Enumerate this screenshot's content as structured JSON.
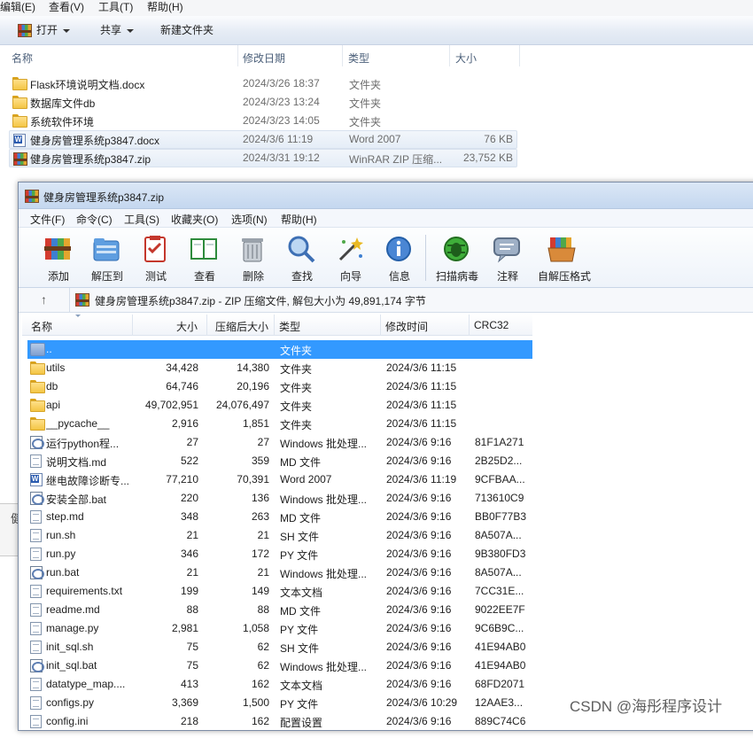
{
  "explorer": {
    "menu": [
      "编辑(E)",
      "查看(V)",
      "工具(T)",
      "帮助(H)"
    ],
    "toolbar": {
      "open": "打开",
      "share": "共享",
      "new_folder": "新建文件夹"
    },
    "columns": {
      "name": "名称",
      "date": "修改日期",
      "type": "类型",
      "size": "大小"
    },
    "rows": [
      {
        "icon": "folder-icon",
        "name": "Flask环境说明文档.docx",
        "date": "2024/3/26 18:37",
        "type": "文件夹",
        "size": ""
      },
      {
        "icon": "folder-icon",
        "name": "数据库文件db",
        "date": "2024/3/23 13:24",
        "type": "文件夹",
        "size": ""
      },
      {
        "icon": "folder-icon",
        "name": "系统软件环境",
        "date": "2024/3/23 14:05",
        "type": "文件夹",
        "size": ""
      },
      {
        "icon": "word-doc-icon",
        "name": "健身房管理系统p3847.docx",
        "date": "2024/3/6 11:19",
        "type": "Word 2007",
        "size": "76 KB"
      },
      {
        "icon": "rar-archive-icon",
        "name": "健身房管理系统p3847.zip",
        "date": "2024/3/31 19:12",
        "type": "WinRAR ZIP 压缩...",
        "size": "23,752 KB"
      }
    ]
  },
  "winrar": {
    "title": "健身房管理系统p3847.zip",
    "menu": [
      "文件(F)",
      "命令(C)",
      "工具(S)",
      "收藏夹(O)",
      "选项(N)",
      "帮助(H)"
    ],
    "tools": [
      {
        "label": "添加",
        "icon": "add-archive-icon"
      },
      {
        "label": "解压到",
        "icon": "extract-to-icon"
      },
      {
        "label": "测试",
        "icon": "test-icon"
      },
      {
        "label": "查看",
        "icon": "view-book-icon"
      },
      {
        "label": "删除",
        "icon": "trash-icon"
      },
      {
        "label": "查找",
        "icon": "find-magnifier-icon"
      },
      {
        "label": "向导",
        "icon": "wizard-wand-icon"
      },
      {
        "label": "信息",
        "icon": "info-icon"
      },
      {
        "label": "扫描病毒",
        "icon": "virus-scan-icon"
      },
      {
        "label": "注释",
        "icon": "comment-icon"
      },
      {
        "label": "自解压格式",
        "icon": "sfx-archive-icon"
      }
    ],
    "address": "健身房管理系统p3847.zip - ZIP 压缩文件, 解包大小为 49,891,174 字节",
    "columns": {
      "name": "名称",
      "size": "大小",
      "packed": "压缩后大小",
      "type": "类型",
      "modified": "修改时间",
      "crc": "CRC32"
    },
    "files": [
      {
        "icon": "parent-folder-icon",
        "name": "..",
        "size": "",
        "packed": "",
        "type": "文件夹",
        "modified": "",
        "crc": "",
        "selected": true
      },
      {
        "icon": "folder-icon",
        "name": "utils",
        "size": "34,428",
        "packed": "14,380",
        "type": "文件夹",
        "modified": "2024/3/6 11:15",
        "crc": ""
      },
      {
        "icon": "folder-icon",
        "name": "db",
        "size": "64,746",
        "packed": "20,196",
        "type": "文件夹",
        "modified": "2024/3/6 11:15",
        "crc": ""
      },
      {
        "icon": "folder-icon",
        "name": "api",
        "size": "49,702,951",
        "packed": "24,076,497",
        "type": "文件夹",
        "modified": "2024/3/6 11:15",
        "crc": ""
      },
      {
        "icon": "folder-icon",
        "name": "__pycache__",
        "size": "2,916",
        "packed": "1,851",
        "type": "文件夹",
        "modified": "2024/3/6 11:15",
        "crc": ""
      },
      {
        "icon": "batch-file-icon",
        "name": "运行python程...",
        "size": "27",
        "packed": "27",
        "type": "Windows 批处理...",
        "modified": "2024/3/6 9:16",
        "crc": "81F1A271"
      },
      {
        "icon": "text-file-icon",
        "name": "说明文档.md",
        "size": "522",
        "packed": "359",
        "type": "MD 文件",
        "modified": "2024/3/6 9:16",
        "crc": "2B25D2..."
      },
      {
        "icon": "word-doc-icon",
        "name": "继电故障诊断专...",
        "size": "77,210",
        "packed": "70,391",
        "type": "Word 2007",
        "modified": "2024/3/6 11:19",
        "crc": "9CFBAA..."
      },
      {
        "icon": "batch-file-icon",
        "name": "安装全部.bat",
        "size": "220",
        "packed": "136",
        "type": "Windows 批处理...",
        "modified": "2024/3/6 9:16",
        "crc": "713610C9"
      },
      {
        "icon": "text-file-icon",
        "name": "step.md",
        "size": "348",
        "packed": "263",
        "type": "MD 文件",
        "modified": "2024/3/6 9:16",
        "crc": "BB0F77B3"
      },
      {
        "icon": "text-file-icon",
        "name": "run.sh",
        "size": "21",
        "packed": "21",
        "type": "SH 文件",
        "modified": "2024/3/6 9:16",
        "crc": "8A507A..."
      },
      {
        "icon": "text-file-icon",
        "name": "run.py",
        "size": "346",
        "packed": "172",
        "type": "PY 文件",
        "modified": "2024/3/6 9:16",
        "crc": "9B380FD3"
      },
      {
        "icon": "batch-file-icon",
        "name": "run.bat",
        "size": "21",
        "packed": "21",
        "type": "Windows 批处理...",
        "modified": "2024/3/6 9:16",
        "crc": "8A507A..."
      },
      {
        "icon": "text-file-icon",
        "name": "requirements.txt",
        "size": "199",
        "packed": "149",
        "type": "文本文档",
        "modified": "2024/3/6 9:16",
        "crc": "7CC31E..."
      },
      {
        "icon": "text-file-icon",
        "name": "readme.md",
        "size": "88",
        "packed": "88",
        "type": "MD 文件",
        "modified": "2024/3/6 9:16",
        "crc": "9022EE7F"
      },
      {
        "icon": "text-file-icon",
        "name": "manage.py",
        "size": "2,981",
        "packed": "1,058",
        "type": "PY 文件",
        "modified": "2024/3/6 9:16",
        "crc": "9C6B9C..."
      },
      {
        "icon": "text-file-icon",
        "name": "init_sql.sh",
        "size": "75",
        "packed": "62",
        "type": "SH 文件",
        "modified": "2024/3/6 9:16",
        "crc": "41E94AB0"
      },
      {
        "icon": "batch-file-icon",
        "name": "init_sql.bat",
        "size": "75",
        "packed": "62",
        "type": "Windows 批处理...",
        "modified": "2024/3/6 9:16",
        "crc": "41E94AB0"
      },
      {
        "icon": "text-file-icon",
        "name": "datatype_map....",
        "size": "413",
        "packed": "162",
        "type": "文本文档",
        "modified": "2024/3/6 9:16",
        "crc": "68FD2071"
      },
      {
        "icon": "text-file-icon",
        "name": "configs.py",
        "size": "3,369",
        "packed": "1,500",
        "type": "PY 文件",
        "modified": "2024/3/6 10:29",
        "crc": "12AAE3..."
      },
      {
        "icon": "text-file-icon",
        "name": "config.ini",
        "size": "218",
        "packed": "162",
        "type": "配置设置",
        "modified": "2024/3/6 9:16",
        "crc": "889C74C6"
      }
    ]
  },
  "watermark": "CSDN @海彤程序设计",
  "left_stub": "健"
}
